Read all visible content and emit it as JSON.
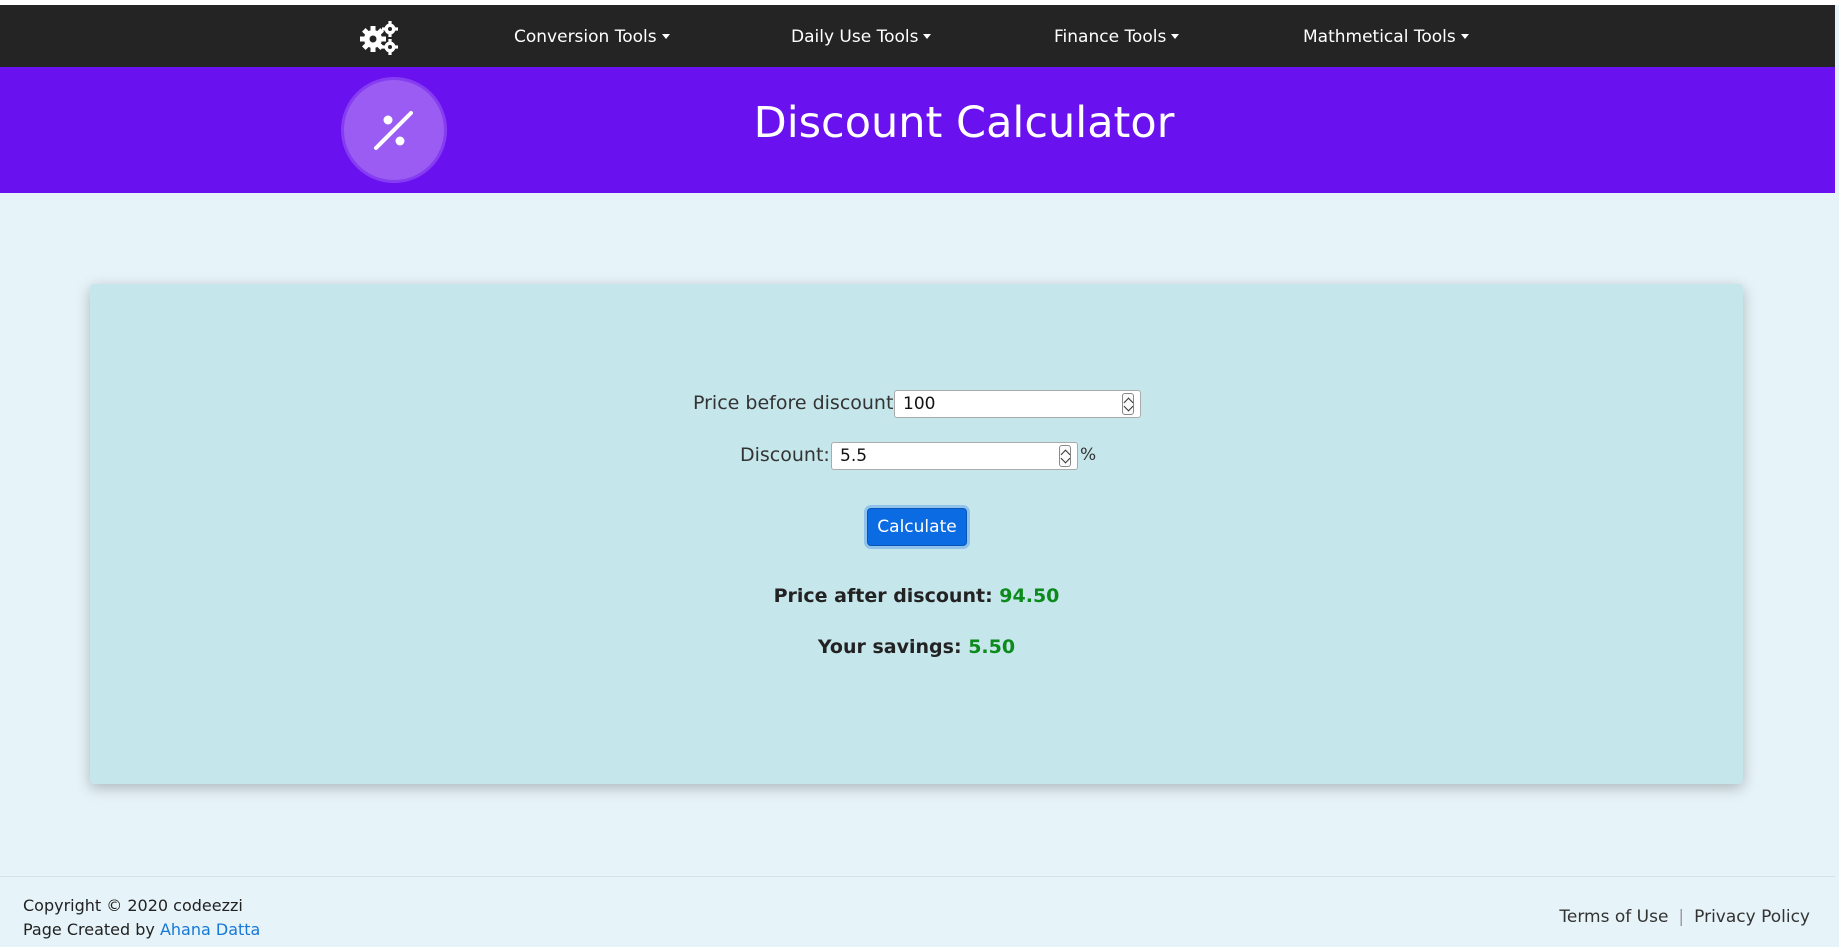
{
  "nav": {
    "items": [
      {
        "label": "Conversion Tools"
      },
      {
        "label": "Daily Use Tools"
      },
      {
        "label": "Finance Tools"
      },
      {
        "label": "Mathmetical Tools"
      }
    ]
  },
  "banner": {
    "title": "Discount Calculator",
    "icon": "percent-icon",
    "accent": "#6a11f0"
  },
  "form": {
    "price_label": "Price before discount:",
    "price_value": "100",
    "discount_label": "Discount:",
    "discount_value": "5.5",
    "discount_unit": "%",
    "calculate_label": "Calculate"
  },
  "results": {
    "after_label": "Price after discount:",
    "after_value": "94.50",
    "savings_label": "Your savings:",
    "savings_value": "5.50",
    "value_color": "#0d8a1c"
  },
  "footer": {
    "copyright": "Copyright © 2020 codeezzi",
    "created_by": "Page Created by",
    "author": "Ahana Datta",
    "terms": "Terms of Use",
    "separator": "|",
    "privacy": "Privacy Policy"
  }
}
